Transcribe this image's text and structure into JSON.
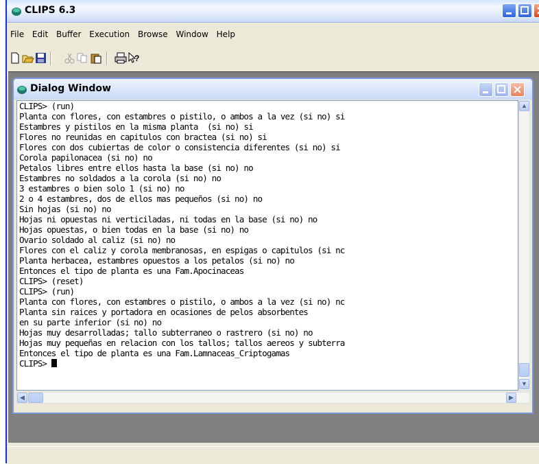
{
  "app": {
    "title": "CLIPS 6.3"
  },
  "menu": [
    "File",
    "Edit",
    "Buffer",
    "Execution",
    "Browse",
    "Window",
    "Help"
  ],
  "toolbar": {
    "buttons": [
      "new-file-icon",
      "open-folder-icon",
      "save-icon",
      "cut-icon",
      "copy-icon",
      "paste-icon",
      "print-icon",
      "context-help-icon"
    ]
  },
  "dialog": {
    "title": "Dialog Window",
    "lines": [
      "CLIPS> (run)",
      "Planta con flores, con estambres o pistilo, o ambos a la vez (si no) si",
      "Estambres y pistilos en la misma planta  (si no) si",
      "Flores no reunidas en capitulos con bractea (si no) si",
      "Flores con dos cubiertas de color o consistencia diferentes (si no) si",
      "Corola papilonacea (si no) no",
      "Petalos libres entre ellos hasta la base (si no) no",
      "Estambres no soldados a la corola (si no) no",
      "3 estambres o bien solo 1 (si no) no",
      "2 o 4 estambres, dos de ellos mas pequeños (si no) no",
      "Sin hojas (si no) no",
      "Hojas ni opuestas ni verticiladas, ni todas en la base (si no) no",
      "Hojas opuestas, o bien todas en la base (si no) no",
      "Ovario soldado al caliz (si no) no",
      "Flores con el caliz y corola membranosas, en espigas o capitulos (si nc",
      "Planta herbacea, estambres opuestos a los petalos (si no) no",
      "Entonces el tipo de planta es una Fam.Apocinaceas",
      "CLIPS> (reset)",
      "CLIPS> (run)",
      "Planta con flores, con estambres o pistilo, o ambos a la vez (si no) nc",
      "Planta sin raices y portadora en ocasiones de pelos absorbentes",
      "en su parte inferior (si no) no",
      "Hojas muy desarrolladas; tallo subterraneo o rastrero (si no) no",
      "Hojas muy pequeñas en relacion con los tallos; tallos aereos y subterra",
      "Entonces el tipo de planta es una Fam.Lamnaceas_Criptogamas"
    ],
    "prompt": "CLIPS> "
  },
  "colors": {
    "xp_blue": "#0831d9",
    "window_face": "#ece9d8",
    "mdi_background": "#808080",
    "console_background": "#ffffff"
  }
}
